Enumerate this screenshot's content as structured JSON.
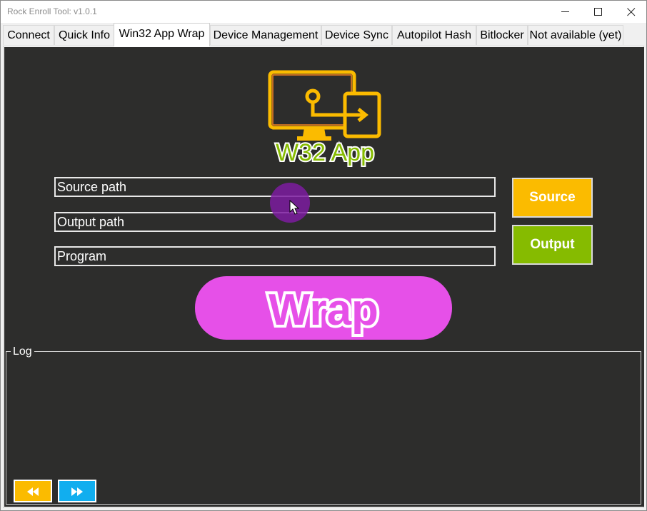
{
  "window": {
    "title": "Rock Enroll Tool: v1.0.1"
  },
  "tabs": [
    {
      "label": "Connect",
      "active": false
    },
    {
      "label": "Quick Info",
      "active": false
    },
    {
      "label": "Win32 App Wrap",
      "active": true
    },
    {
      "label": "Device Management",
      "active": false
    },
    {
      "label": "Device Sync",
      "active": false
    },
    {
      "label": "Autopilot Hash",
      "active": false
    },
    {
      "label": "Bitlocker",
      "active": false
    },
    {
      "label": "Not available (yet)",
      "active": false
    }
  ],
  "logo": {
    "text": "W32 App",
    "icon": "monitor-arrow-icon",
    "primary_color": "#fbbb00",
    "text_color": "#86bb00"
  },
  "fields": {
    "source_placeholder": "Source path",
    "output_placeholder": "Output path",
    "program_placeholder": "Program"
  },
  "buttons": {
    "source_label": "Source",
    "output_label": "Output",
    "wrap_label": "Wrap",
    "prev_icon": "rewind-icon",
    "next_icon": "fast-forward-icon"
  },
  "log": {
    "label": "Log"
  },
  "colors": {
    "background": "#2d2d2c",
    "source_button": "#fbbb00",
    "output_button": "#86bb00",
    "wrap_button": "#e650e8",
    "next_button": "#11aeef"
  }
}
